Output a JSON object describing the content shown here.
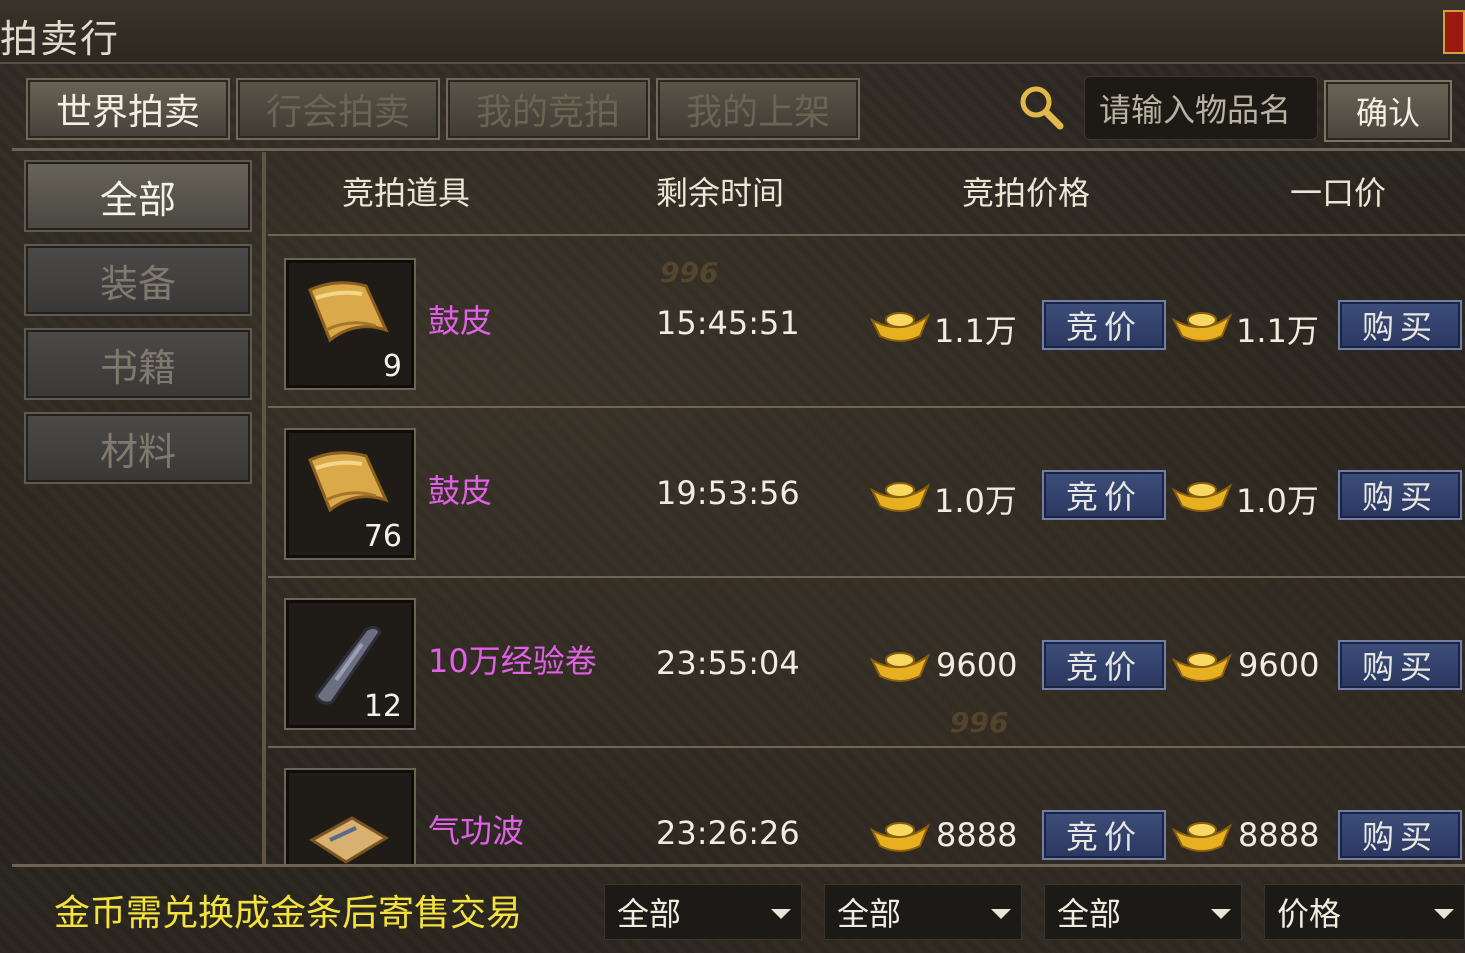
{
  "window": {
    "title": "拍卖行"
  },
  "tabs": [
    "世界拍卖",
    "行会拍卖",
    "我的竞拍",
    "我的上架"
  ],
  "search": {
    "placeholder": "请输入物品名",
    "confirm_label": "确认"
  },
  "categories": [
    "全部",
    "装备",
    "书籍",
    "材料"
  ],
  "columns": {
    "item": "竞拍道具",
    "time": "剩余时间",
    "bid_price": "竞拍价格",
    "buyout": "一口价"
  },
  "buttons": {
    "bid": "竞价",
    "buy": "购买"
  },
  "listings": [
    {
      "name": "鼓皮",
      "qty": "9",
      "time": "15:45:51",
      "bid": "1.1万",
      "buyout": "1.1万",
      "icon": "scroll-icon"
    },
    {
      "name": "鼓皮",
      "qty": "76",
      "time": "19:53:56",
      "bid": "1.0万",
      "buyout": "1.0万",
      "icon": "scroll-icon"
    },
    {
      "name": "10万经验卷",
      "qty": "12",
      "time": "23:55:04",
      "bid": "9600",
      "buyout": "9600",
      "icon": "rolled-scroll-icon"
    },
    {
      "name": "气功波",
      "qty": "",
      "time": "23:26:26",
      "bid": "8888",
      "buyout": "8888",
      "icon": "skill-book-icon"
    }
  ],
  "footer": {
    "notice": "金币需兑换成金条后寄售交易",
    "filters": [
      "全部",
      "全部",
      "全部",
      "价格"
    ]
  },
  "colors": {
    "item_name": "#e060e6",
    "notice": "#f4e23c",
    "button_blue": "#2f3d6a"
  }
}
